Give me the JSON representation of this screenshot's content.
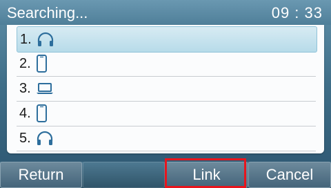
{
  "status_bar": {
    "title": "Searching...",
    "clock": "09 : 33"
  },
  "devices": [
    {
      "number": "1.",
      "icon": "headset-icon",
      "selected": true
    },
    {
      "number": "2.",
      "icon": "mobile-phone-icon",
      "selected": false
    },
    {
      "number": "3.",
      "icon": "laptop-icon",
      "selected": false
    },
    {
      "number": "4.",
      "icon": "mobile-phone-icon",
      "selected": false
    },
    {
      "number": "5.",
      "icon": "headset-icon",
      "selected": false
    }
  ],
  "softkeys": {
    "return_label": "Return",
    "empty_label": "",
    "link_label": "Link",
    "cancel_label": "Cancel"
  },
  "colors": {
    "accent": "#2d6e9c",
    "highlight": "#e8151d",
    "selected_row": "#c4e2ee"
  }
}
